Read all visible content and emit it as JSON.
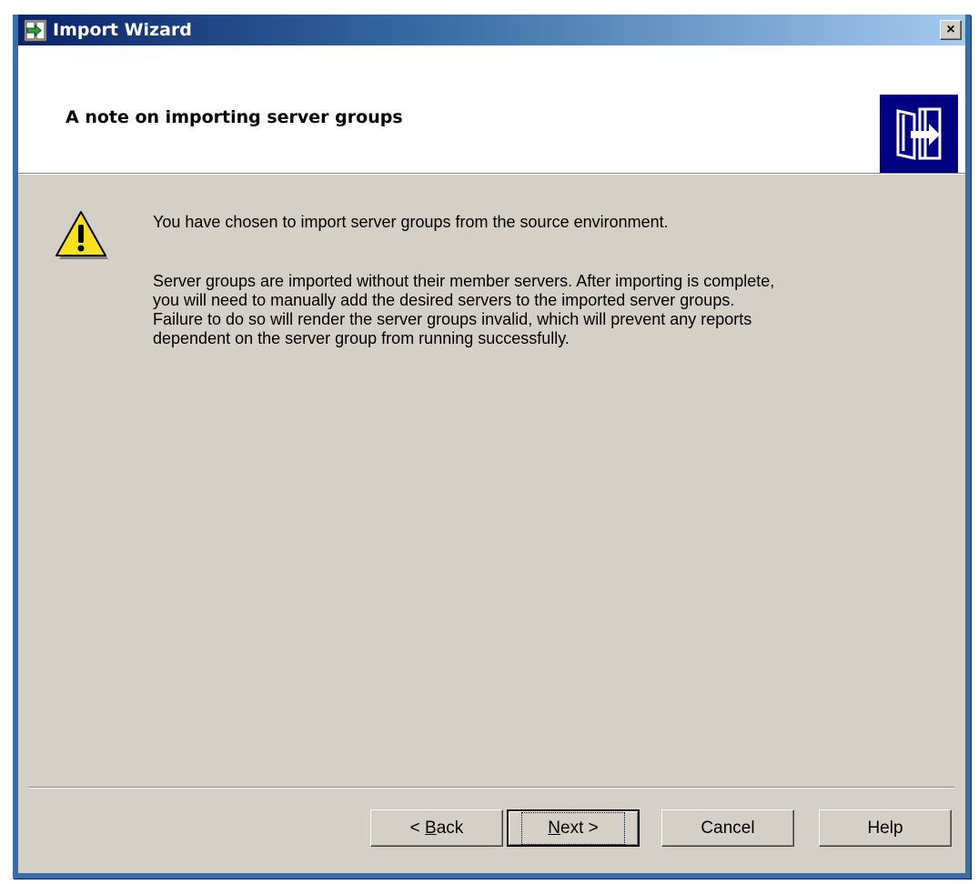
{
  "window": {
    "title": "Import Wizard",
    "close_glyph": "×"
  },
  "header": {
    "title": "A note on importing server groups"
  },
  "content": {
    "paragraph1": "You have chosen to import server groups from the source environment.",
    "paragraph2_lines": [
      "Server groups are imported without their member servers. After importing is complete,",
      "you will need to manually add the desired servers to the imported server groups.",
      "Failure to do so will render the server groups invalid, which will prevent any reports",
      "dependent on the server group from running successfully."
    ]
  },
  "buttons": {
    "back": {
      "prefix": "< ",
      "mnemonic": "B",
      "rest": "ack"
    },
    "next": {
      "mnemonic": "N",
      "rest": "ext >"
    },
    "cancel": "Cancel",
    "help": "Help"
  },
  "icons": {
    "app": "import-wizard-icon",
    "warning": "warning-icon",
    "header_graphic": "import-graphic-icon"
  },
  "colors": {
    "titlebar_start": "#0a246a",
    "titlebar_end": "#a6caf0",
    "dialog_face": "#d4d0c8",
    "header_graphic_bg": "#000080",
    "warning_yellow": "#f8e020"
  }
}
